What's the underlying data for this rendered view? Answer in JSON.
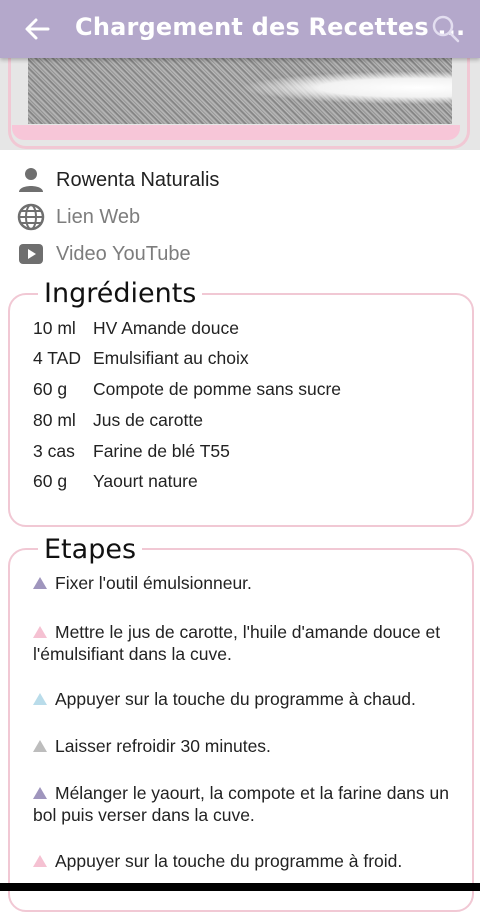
{
  "appbar": {
    "title": "Chargement des Recettes ..."
  },
  "links": {
    "author": "Rowenta Naturalis",
    "web": "Lien Web",
    "video": "Video YouTube"
  },
  "ingredients": {
    "title": "Ingrédients",
    "items": [
      {
        "qty": "10 ml",
        "name": "HV Amande douce"
      },
      {
        "qty": "4 TAD",
        "name": "Emulsifiant au choix"
      },
      {
        "qty": "60 g",
        "name": "Compote de pomme sans sucre"
      },
      {
        "qty": "80 ml",
        "name": "Jus de carotte"
      },
      {
        "qty": "3 cas",
        "name": "Farine de blé T55"
      },
      {
        "qty": "60 g",
        "name": "Yaourt nature"
      }
    ]
  },
  "steps": {
    "title": "Etapes",
    "items": [
      {
        "text": "Fixer l'outil émulsionneur.",
        "color": "#9f95bd"
      },
      {
        "text": "Mettre le jus de carotte, l'huile d'amande douce et l'émulsifiant dans la cuve.",
        "color": "#f5c1d2"
      },
      {
        "text": "Appuyer sur la touche du programme à chaud.",
        "color": "#b9dcea"
      },
      {
        "text": "Laisser refroidir 30 minutes.",
        "color": "#bdbdbd"
      },
      {
        "text": "Mélanger le yaourt, la compote et la farine dans un bol puis verser dans la cuve.",
        "color": "#9f95bd"
      },
      {
        "text": "Appuyer sur la touche du programme à froid.",
        "color": "#f5c1d2"
      }
    ]
  },
  "colors": {
    "appbar": "#b4a8cb",
    "card_border": "#f1c8d4"
  }
}
